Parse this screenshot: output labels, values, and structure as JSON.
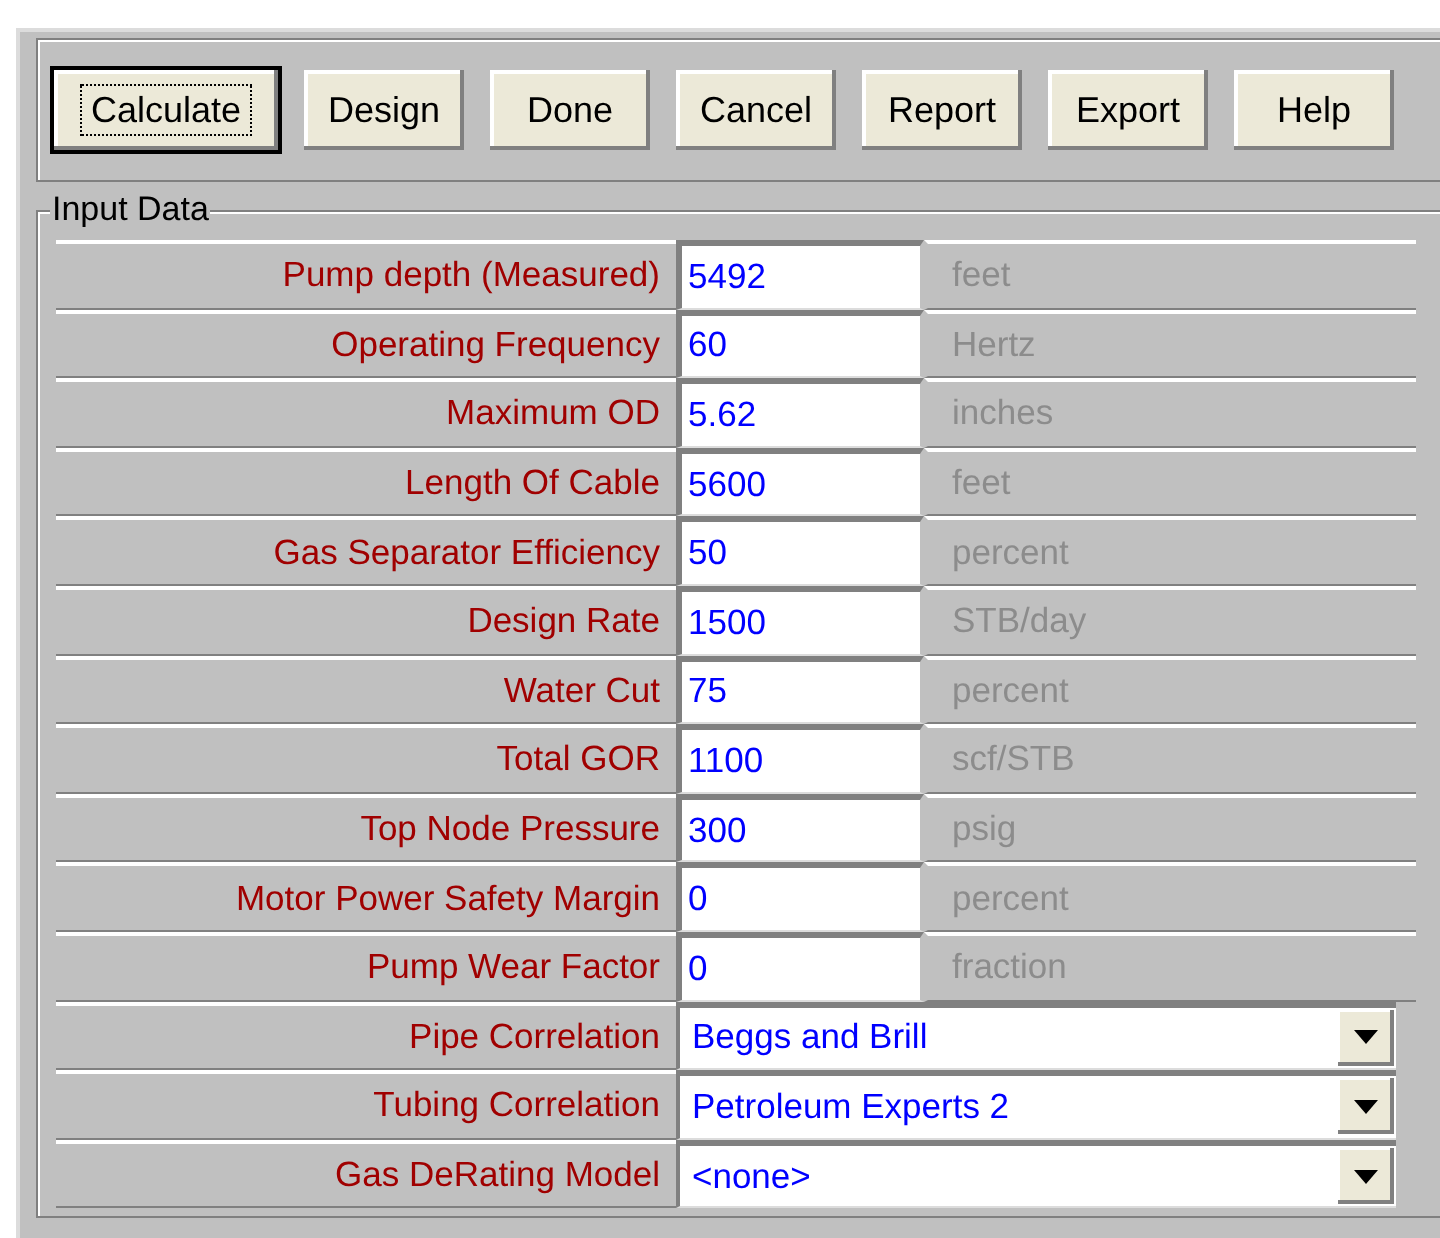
{
  "toolbar": {
    "buttons": [
      {
        "label": "Calculate",
        "focused": true
      },
      {
        "label": "Design",
        "focused": false
      },
      {
        "label": "Done",
        "focused": false
      },
      {
        "label": "Cancel",
        "focused": false
      },
      {
        "label": "Report",
        "focused": false
      },
      {
        "label": "Export",
        "focused": false
      },
      {
        "label": "Help",
        "focused": false
      }
    ]
  },
  "input_data": {
    "title": "Input Data",
    "rows": [
      {
        "kind": "field",
        "label": "Pump depth (Measured)",
        "value": "5492",
        "unit": "feet"
      },
      {
        "kind": "field",
        "label": "Operating Frequency",
        "value": "60",
        "unit": "Hertz"
      },
      {
        "kind": "field",
        "label": "Maximum OD",
        "value": "5.62",
        "unit": "inches"
      },
      {
        "kind": "field",
        "label": "Length Of Cable",
        "value": "5600",
        "unit": "feet"
      },
      {
        "kind": "field",
        "label": "Gas Separator Efficiency",
        "value": "50",
        "unit": "percent"
      },
      {
        "kind": "field",
        "label": "Design Rate",
        "value": "1500",
        "unit": "STB/day"
      },
      {
        "kind": "field",
        "label": "Water Cut",
        "value": "75",
        "unit": "percent"
      },
      {
        "kind": "field",
        "label": "Total GOR",
        "value": "1100",
        "unit": "scf/STB"
      },
      {
        "kind": "field",
        "label": "Top Node Pressure",
        "value": "300",
        "unit": "psig"
      },
      {
        "kind": "field",
        "label": "Motor Power Safety Margin",
        "value": "0",
        "unit": "percent"
      },
      {
        "kind": "field",
        "label": "Pump Wear Factor",
        "value": "0",
        "unit": "fraction"
      },
      {
        "kind": "dropdown",
        "label": "Pipe Correlation",
        "value": "Beggs and Brill"
      },
      {
        "kind": "dropdown",
        "label": "Tubing Correlation",
        "value": "Petroleum Experts 2"
      },
      {
        "kind": "dropdown",
        "label": "Gas DeRating Model",
        "value": "<none>"
      }
    ]
  }
}
